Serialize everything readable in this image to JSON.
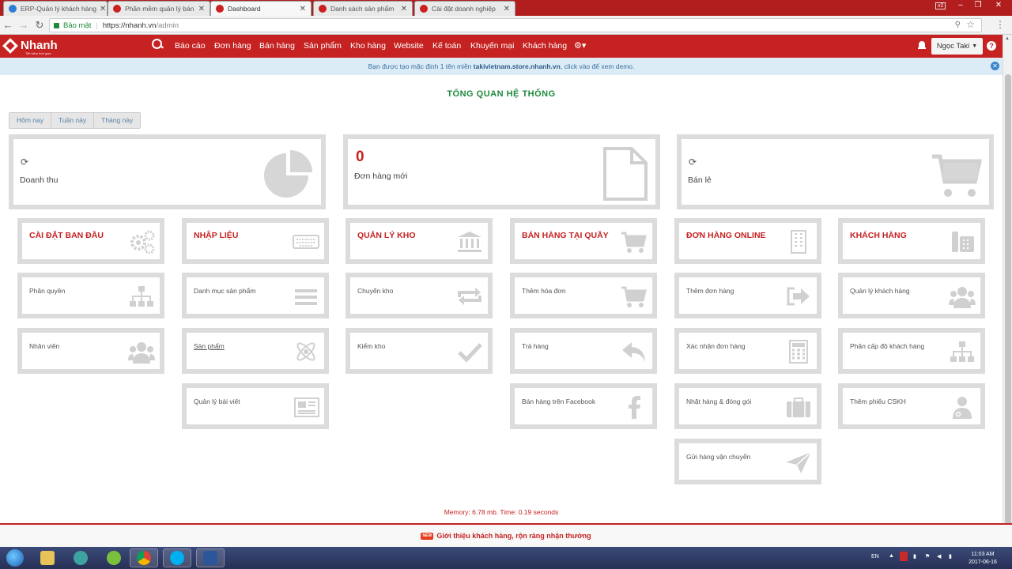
{
  "browser": {
    "tabs": [
      {
        "title": "ERP-Quản lý khách hàng",
        "active": false
      },
      {
        "title": "Phần mềm quản lý bán",
        "active": false
      },
      {
        "title": "Dashboard",
        "active": true
      },
      {
        "title": "Danh sách sản phẩm",
        "active": false
      },
      {
        "title": "Cài đặt doanh nghiệp",
        "active": false
      }
    ],
    "user_badge": "v2",
    "secure_label": "Bảo mật",
    "url_host": "https://nhanh.vn",
    "url_path": "/admin"
  },
  "navbar": {
    "logo": "Nhanh",
    "logo_tagline": "Tiết kiệm thời gian",
    "items": [
      "Báo cáo",
      "Đơn hàng",
      "Bán hàng",
      "Sản phẩm",
      "Kho hàng",
      "Website",
      "Kế toán",
      "Khuyến mại",
      "Khách hàng"
    ],
    "user_name": "Ngọc Taki"
  },
  "notice": {
    "prefix": "Bạn được tạo mặc định 1 tên miền",
    "domain": "takivietnam.store.nhanh.vn",
    "suffix": ", click vào để xem demo."
  },
  "page": {
    "title": "TỔNG QUAN HỆ THỐNG",
    "periods": [
      "Hôm nay",
      "Tuần này",
      "Tháng này"
    ]
  },
  "stats": {
    "revenue_label": "Doanh thu",
    "new_orders_value": "0",
    "new_orders_label": "Đơn hàng mới",
    "retail_label": "Bán lẻ"
  },
  "columns": [
    {
      "title": "CÀI ĐẶT BAN ĐẦU",
      "items": [
        "Phân quyền",
        "Nhân viên"
      ]
    },
    {
      "title": "NHẬP LIỆU",
      "items": [
        "Danh mục sản phẩm",
        "Sản phẩm",
        "Quản lý bài viết"
      ]
    },
    {
      "title": "QUẢN LÝ KHO",
      "items": [
        "Chuyển kho",
        "Kiểm kho"
      ]
    },
    {
      "title": "BÁN HÀNG TẠI QUẦY",
      "items": [
        "Thêm hóa đơn",
        "Trả hàng",
        "Bán hàng trên Facebook"
      ]
    },
    {
      "title": "ĐƠN HÀNG ONLINE",
      "items": [
        "Thêm đơn hàng",
        "Xác nhận đơn hàng",
        "Nhặt hàng & đóng gói",
        "Gửi hàng vận chuyển"
      ]
    },
    {
      "title": "KHÁCH HÀNG",
      "items": [
        "Quản lý khách hàng",
        "Phân cấp độ khách hàng",
        "Thêm phiếu CSKH"
      ]
    }
  ],
  "footer": {
    "memory": "Memory: 6.78 mb. Time: 0.19 seconds",
    "promo": "Giới thiệu khách hàng, rộn ràng nhận thưởng"
  },
  "taskbar": {
    "lang": "EN",
    "time": "11:03 AM",
    "date": "2017-06-16"
  },
  "colors": {
    "brand_red": "#c62222",
    "title_green": "#1e8a3c",
    "tile_border": "#dcdcdc",
    "icon_gray": "#d0d0d0"
  }
}
